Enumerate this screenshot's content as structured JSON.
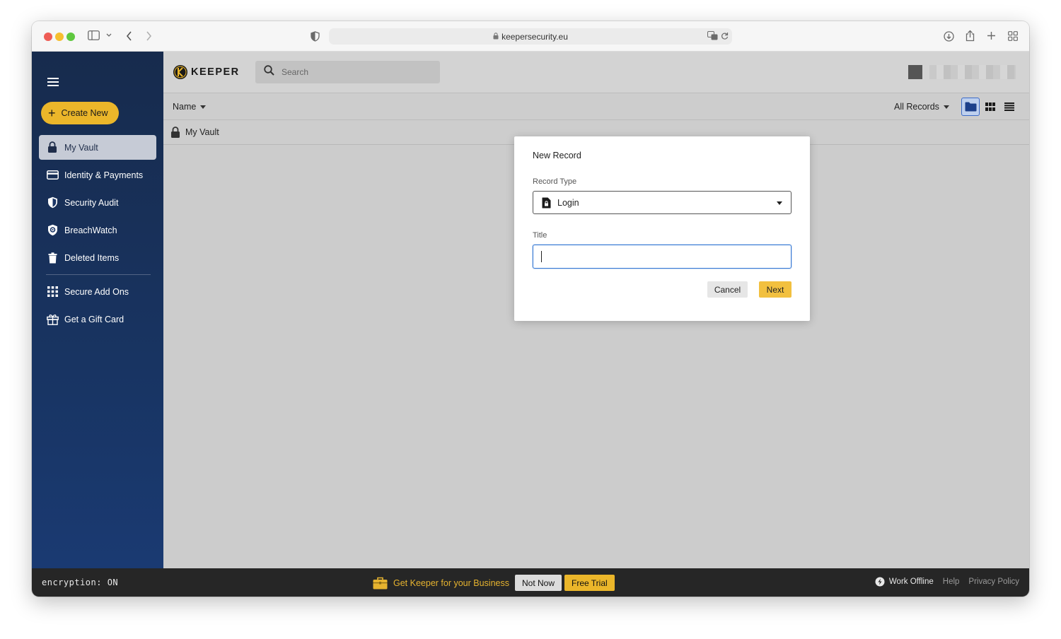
{
  "browser": {
    "url": "keepersecurity.eu",
    "icons": [
      "sidebar-toggle-icon",
      "chevron-down-icon",
      "back-icon",
      "forward-icon",
      "shield-icon",
      "lock-icon",
      "translate-icon",
      "reload-icon",
      "download-icon",
      "share-icon",
      "new-tab-icon",
      "tab-overview-icon"
    ]
  },
  "brand": {
    "name": "KEEPER",
    "accent": "#ebb62a",
    "sidebar_color": "#172b4d"
  },
  "sidebar": {
    "create_new": "Create New",
    "items": [
      {
        "label": "My Vault",
        "icon": "lock-icon",
        "active": true
      },
      {
        "label": "Identity & Payments",
        "icon": "credit-card-icon",
        "active": false
      },
      {
        "label": "Security Audit",
        "icon": "shield-icon",
        "active": false
      },
      {
        "label": "BreachWatch",
        "icon": "breachwatch-icon",
        "active": false
      },
      {
        "label": "Deleted Items",
        "icon": "trash-icon",
        "active": false
      },
      {
        "label": "Secure Add Ons",
        "icon": "grid-icon",
        "active": false
      },
      {
        "label": "Get a Gift Card",
        "icon": "gift-icon",
        "active": false
      }
    ]
  },
  "header": {
    "search_placeholder": "Search"
  },
  "sortbar": {
    "sort_label": "Name",
    "filter_label": "All Records"
  },
  "vault_row": {
    "label": "My Vault"
  },
  "modal": {
    "title": "New Record",
    "record_type_label": "Record Type",
    "record_type_value": "Login",
    "title_label": "Title",
    "title_value": "",
    "cancel": "Cancel",
    "next": "Next"
  },
  "footer": {
    "encryption": "encryption: ON",
    "promo": "Get Keeper for your Business",
    "not_now": "Not Now",
    "free_trial": "Free Trial",
    "work_offline": "Work Offline",
    "help": "Help",
    "privacy": "Privacy Policy"
  }
}
